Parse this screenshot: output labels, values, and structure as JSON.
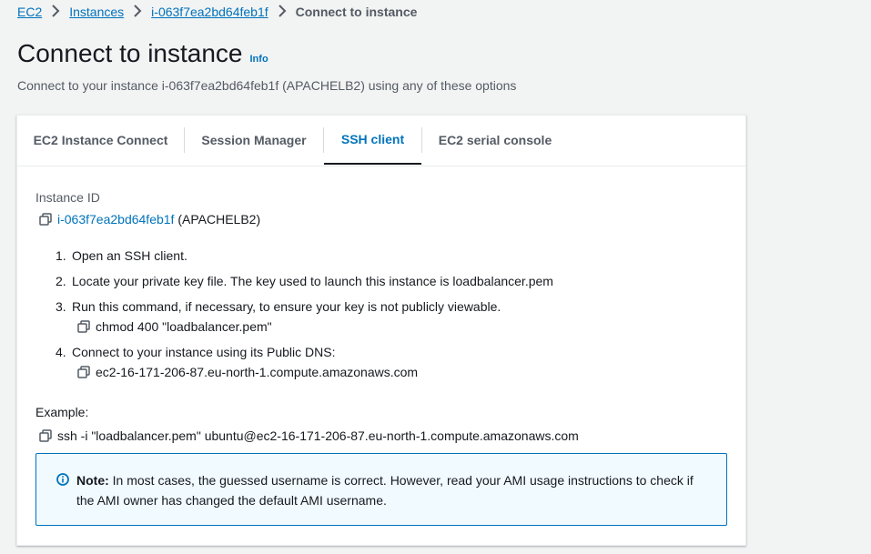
{
  "breadcrumb": {
    "items": [
      "EC2",
      "Instances",
      "i-063f7ea2bd64feb1f"
    ],
    "current": "Connect to instance"
  },
  "header": {
    "title": "Connect to instance",
    "info": "Info",
    "subtitle": "Connect to your instance i-063f7ea2bd64feb1f (APACHELB2) using any of these options"
  },
  "tabs": [
    {
      "label": "EC2 Instance Connect",
      "active": false
    },
    {
      "label": "Session Manager",
      "active": false
    },
    {
      "label": "SSH client",
      "active": true
    },
    {
      "label": "EC2 serial console",
      "active": false
    }
  ],
  "instance": {
    "label": "Instance ID",
    "id": "i-063f7ea2bd64feb1f",
    "name": "(APACHELB2)"
  },
  "steps": [
    {
      "num": "1.",
      "text": "Open an SSH client."
    },
    {
      "num": "2.",
      "text": "Locate your private key file. The key used to launch this instance is loadbalancer.pem"
    },
    {
      "num": "3.",
      "text": "Run this command, if necessary, to ensure your key is not publicly viewable.",
      "command": "chmod 400 \"loadbalancer.pem\""
    },
    {
      "num": "4.",
      "text": "Connect to your instance using its Public DNS:",
      "command": "ec2-16-171-206-87.eu-north-1.compute.amazonaws.com"
    }
  ],
  "example": {
    "label": "Example:",
    "command": "ssh -i \"loadbalancer.pem\" ubuntu@ec2-16-171-206-87.eu-north-1.compute.amazonaws.com"
  },
  "note": {
    "prefix": "Note:",
    "text": "In most cases, the guessed username is correct. However, read your AMI usage instructions to check if the AMI owner has changed the default AMI username."
  },
  "colors": {
    "link": "#0073bb",
    "info_bg": "#f1faff",
    "active_tab": "#0073bb"
  }
}
